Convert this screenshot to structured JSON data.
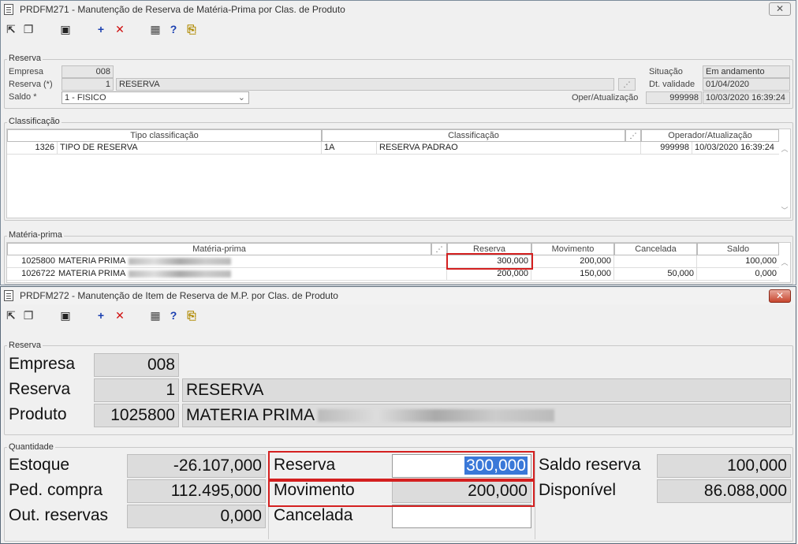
{
  "win1": {
    "title": "PRDFM271 - Manutenção de Reserva de Matéria-Prima por Clas. de Produto",
    "close": "✕",
    "reserva_group": {
      "title": "Reserva",
      "empresa_label": "Empresa",
      "empresa_value": "008",
      "reserva_label": "Reserva (*)",
      "reserva_value": "1",
      "reserva_desc": "RESERVA",
      "saldo_label": "Saldo *",
      "saldo_value": "1 - FISICO",
      "situacao_label": "Situação",
      "situacao_value": "Em andamento",
      "dtvalidade_label": "Dt. validade",
      "dtvalidade_value": "01/04/2020",
      "oper_label": "Oper/Atualização",
      "oper_user": "999998",
      "oper_date": "10/03/2020 16:39:24"
    },
    "classificacao_group": {
      "title": "Classificação",
      "headers": [
        "Tipo classificação",
        "Classificação",
        "Operador/Atualização"
      ],
      "row": {
        "tipo_code": "1326",
        "tipo_desc": "TIPO DE RESERVA",
        "class_code": "1A",
        "class_desc": "RESERVA PADRAO",
        "oper_user": "999998",
        "oper_date": "10/03/2020 16:39:24"
      }
    },
    "materia_group": {
      "title": "Matéria-prima",
      "headers": [
        "Matéria-prima",
        "Reserva",
        "Movimento",
        "Cancelada",
        "Saldo"
      ],
      "rows": [
        {
          "code": "1025800",
          "name": "MATERIA PRIMA",
          "reserva": "300,000",
          "movimento": "200,000",
          "cancelada": "",
          "saldo": "100,000"
        },
        {
          "code": "1026722",
          "name": "MATERIA PRIMA",
          "reserva": "200,000",
          "movimento": "150,000",
          "cancelada": "50,000",
          "saldo": "0,000"
        }
      ]
    }
  },
  "win2": {
    "title": "PRDFM272 - Manutenção de Item de Reserva de M.P. por Clas. de Produto",
    "close": "✕",
    "reserva_group": {
      "title": "Reserva",
      "empresa_label": "Empresa",
      "empresa_value": "008",
      "reserva_label": "Reserva",
      "reserva_value": "1",
      "reserva_desc": "RESERVA",
      "produto_label": "Produto",
      "produto_value": "1025800",
      "produto_desc": "MATERIA PRIMA"
    },
    "quantidade_group": {
      "title": "Quantidade",
      "estoque_label": "Estoque",
      "estoque_value": "-26.107,000",
      "pedcompra_label": "Ped. compra",
      "pedcompra_value": "112.495,000",
      "outreservas_label": "Out. reservas",
      "outreservas_value": "0,000",
      "reserva_label": "Reserva",
      "reserva_value": "300,000",
      "movimento_label": "Movimento",
      "movimento_value": "200,000",
      "cancelada_label": "Cancelada",
      "cancelada_value": "",
      "saldo_label": "Saldo reserva",
      "saldo_value": "100,000",
      "disponivel_label": "Disponível",
      "disponivel_value": "86.088,000"
    }
  },
  "colors": {
    "highlight": "#d42020",
    "selection": "#3a78d8"
  },
  "toolbar_icons": [
    "export-icon",
    "copy-icon",
    "save-icon",
    "add-icon",
    "delete-icon",
    "grid-icon",
    "help-icon",
    "exit-icon"
  ]
}
